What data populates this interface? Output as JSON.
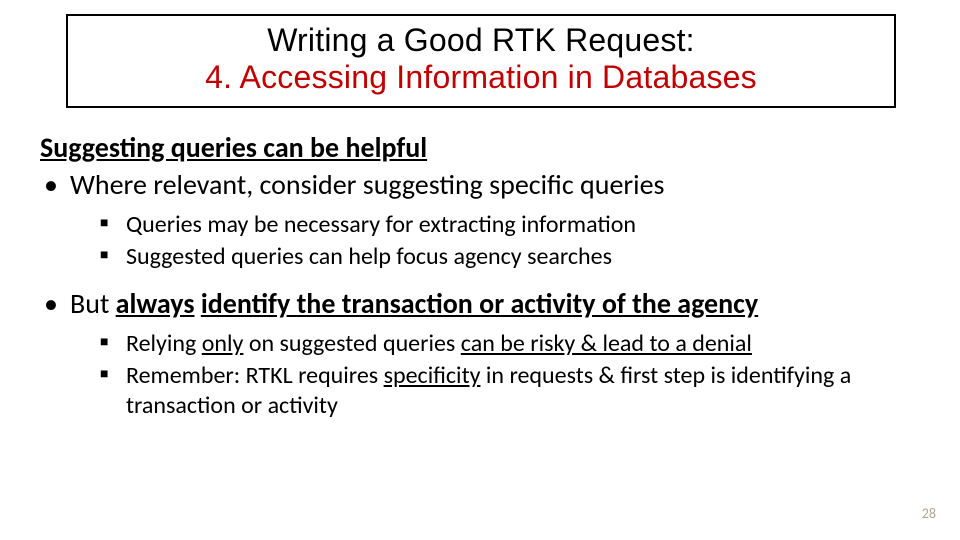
{
  "title": {
    "line1": "Writing a Good RTK Request:",
    "line2": "4. Accessing Information in Databases"
  },
  "subhead": "Suggesting queries can be helpful",
  "bullet1": {
    "text": "Where relevant, consider suggesting specific queries",
    "sub1": "Queries may be necessary for extracting information",
    "sub2": "Suggested queries can help focus agency searches"
  },
  "bullet2": {
    "pre": "But ",
    "always": "always",
    "mid": " ",
    "rest": "identify the transaction or activity of the agency",
    "sub1": {
      "a": "Relying ",
      "only": "only",
      "b": " on suggested queries ",
      "risk": "can be risky & lead to a denial"
    },
    "sub2": {
      "a": "Remember: RTKL requires ",
      "spec": "specificity",
      "b": " in requests & first step is identifying a transaction or activity"
    }
  },
  "page": "28"
}
